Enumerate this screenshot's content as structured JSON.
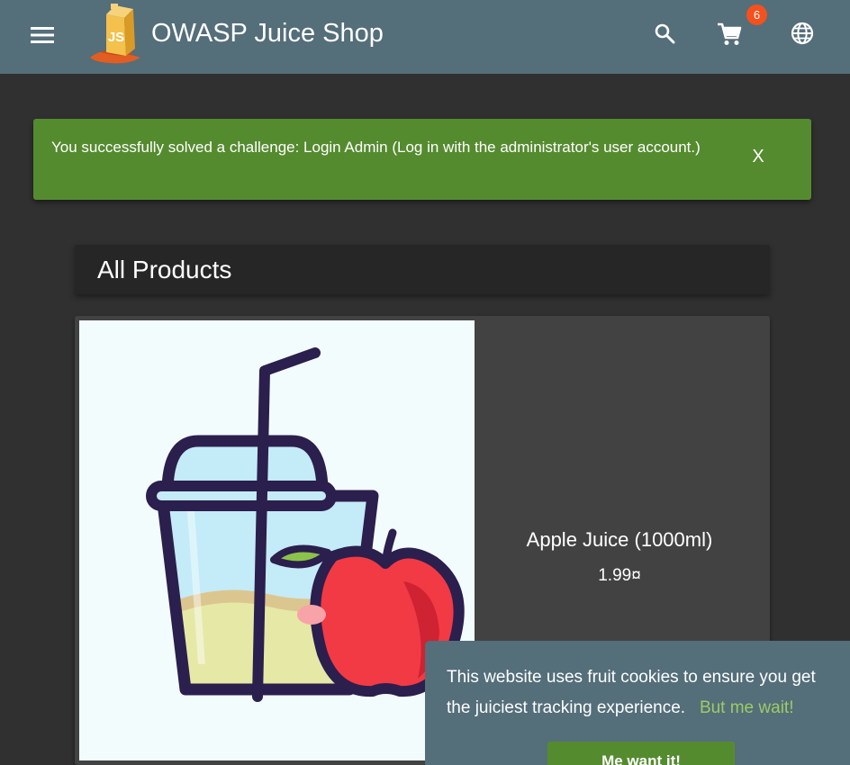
{
  "header": {
    "app_title": "OWASP Juice Shop",
    "logo_text": "JS",
    "menu_icon": "menu-icon",
    "search_icon": "search-icon",
    "cart_icon": "cart-icon",
    "cart_count": "6",
    "language_icon": "language-icon"
  },
  "notification": {
    "message": "You successfully solved a challenge: Login Admin (Log in with the administrator's user account.)",
    "close_label": "X"
  },
  "products": {
    "heading": "All Products",
    "items": [
      {
        "name": "Apple Juice (1000ml)",
        "price": "1.99¤"
      }
    ]
  },
  "cookie_notice": {
    "message": "This website uses fruit cookies to ensure you get the juiciest tracking experience.",
    "link_label": "But me wait!",
    "accept_label": "Me want it!"
  },
  "colors": {
    "toolbar": "#546e7a",
    "background": "#303030",
    "success": "#558b2f",
    "card": "#424242",
    "badge": "#f4511e",
    "link": "#9ccc65"
  }
}
